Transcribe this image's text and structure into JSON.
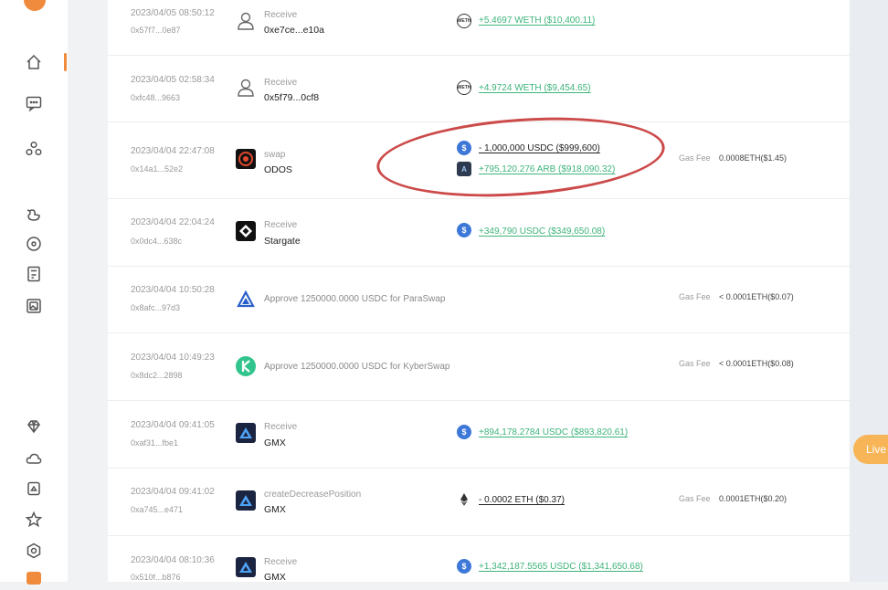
{
  "sidebar": {
    "items": [
      {
        "icon": "home-icon"
      },
      {
        "icon": "chat-icon"
      },
      {
        "icon": "people-icon"
      },
      {
        "icon": "duck-icon"
      },
      {
        "icon": "disc-icon"
      },
      {
        "icon": "calculator-icon"
      },
      {
        "icon": "image-icon"
      },
      {
        "icon": "diamond-icon"
      },
      {
        "icon": "cloud-icon"
      },
      {
        "icon": "bag-icon"
      },
      {
        "icon": "star-icon"
      },
      {
        "icon": "settings-icon"
      }
    ]
  },
  "live_button": "Live",
  "colors": {
    "accent": "#f08a3c",
    "positive": "#3db47a",
    "annotation": "#cc4a4a",
    "usdc": "#3d78d8"
  },
  "rows": [
    {
      "timestamp": "2023/04/05 08:50:12",
      "hash": "0x57f7...0e87",
      "type": "Receive",
      "party": "0xe7ce...e10a",
      "tokens": [
        {
          "icon": "weth-icon",
          "amount": "+5.4697 WETH ($10,400.11)"
        }
      ],
      "gas_label": "",
      "gas_value": ""
    },
    {
      "timestamp": "2023/04/05 02:58:34",
      "hash": "0xfc48...9663",
      "type": "Receive",
      "party": "0x5f79...0cf8",
      "tokens": [
        {
          "icon": "weth-icon",
          "amount": "+4.9724 WETH ($9,454.65)"
        }
      ],
      "gas_label": "",
      "gas_value": ""
    },
    {
      "timestamp": "2023/04/04 22:47:08",
      "hash": "0x14a1...52e2",
      "type": "swap",
      "party": "ODOS",
      "tokens": [
        {
          "icon": "usdc-icon",
          "amount": "- 1,000,000 USDC ($999,600)"
        },
        {
          "icon": "arb-icon",
          "amount": "+795,120.276 ARB ($918,090.32)"
        }
      ],
      "gas_label": "Gas Fee",
      "gas_value": "0.0008ETH($1.45)"
    },
    {
      "timestamp": "2023/04/04 22:04:24",
      "hash": "0x0dc4...638c",
      "type": "Receive",
      "party": "Stargate",
      "tokens": [
        {
          "icon": "usdc-icon",
          "amount": "+349,790 USDC ($349,650.08)"
        }
      ],
      "gas_label": "",
      "gas_value": ""
    },
    {
      "timestamp": "2023/04/04 10:50:28",
      "hash": "0x8afc...97d3",
      "approve": "Approve 1250000.0000 USDC for ParaSwap",
      "gas_label": "Gas Fee",
      "gas_value": "< 0.0001ETH($0.07)"
    },
    {
      "timestamp": "2023/04/04 10:49:23",
      "hash": "0x8dc2...2898",
      "approve": "Approve 1250000.0000 USDC for KyberSwap",
      "gas_label": "Gas Fee",
      "gas_value": "< 0.0001ETH($0.08)"
    },
    {
      "timestamp": "2023/04/04 09:41:05",
      "hash": "0xaf31...fbe1",
      "type": "Receive",
      "party": "GMX",
      "tokens": [
        {
          "icon": "usdc-icon",
          "amount": "+894,178.2784 USDC ($893,820.61)"
        }
      ],
      "gas_label": "",
      "gas_value": ""
    },
    {
      "timestamp": "2023/04/04 09:41:02",
      "hash": "0xa745...e471",
      "type": "createDecreasePosition",
      "party": "GMX",
      "tokens": [
        {
          "icon": "eth-icon",
          "amount": "- 0.0002 ETH ($0.37)"
        }
      ],
      "gas_label": "Gas Fee",
      "gas_value": "0.0001ETH($0.20)"
    },
    {
      "timestamp": "2023/04/04 08:10:36",
      "hash": "0x510f...b876",
      "type": "Receive",
      "party": "GMX",
      "tokens": [
        {
          "icon": "usdc-icon",
          "amount": "+1,342,187.5565 USDC ($1,341,650.68)"
        }
      ],
      "gas_label": "",
      "gas_value": ""
    }
  ]
}
